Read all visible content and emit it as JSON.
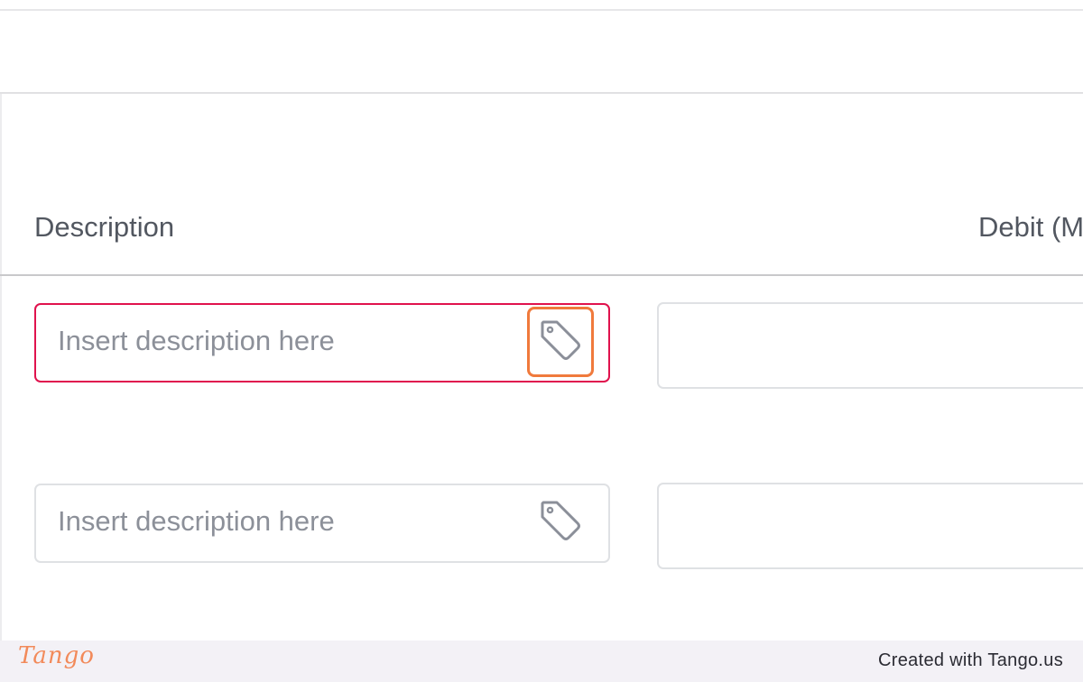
{
  "table": {
    "headers": {
      "description": "Description",
      "debit": "Debit (M"
    },
    "rows": [
      {
        "description_placeholder": "Insert description here",
        "state": "error",
        "tag_icon": "tag-icon",
        "tag_highlighted": true
      },
      {
        "description_placeholder": "Insert description here",
        "state": "normal",
        "tag_icon": "tag-icon",
        "tag_highlighted": false
      }
    ]
  },
  "colors": {
    "error_border": "#e0124d",
    "highlight": "#f07a3c",
    "placeholder_text": "#8c9099",
    "footer_bg": "#f3f1f6"
  },
  "footer": {
    "logo": "Tango",
    "credit": "Created with Tango.us"
  }
}
